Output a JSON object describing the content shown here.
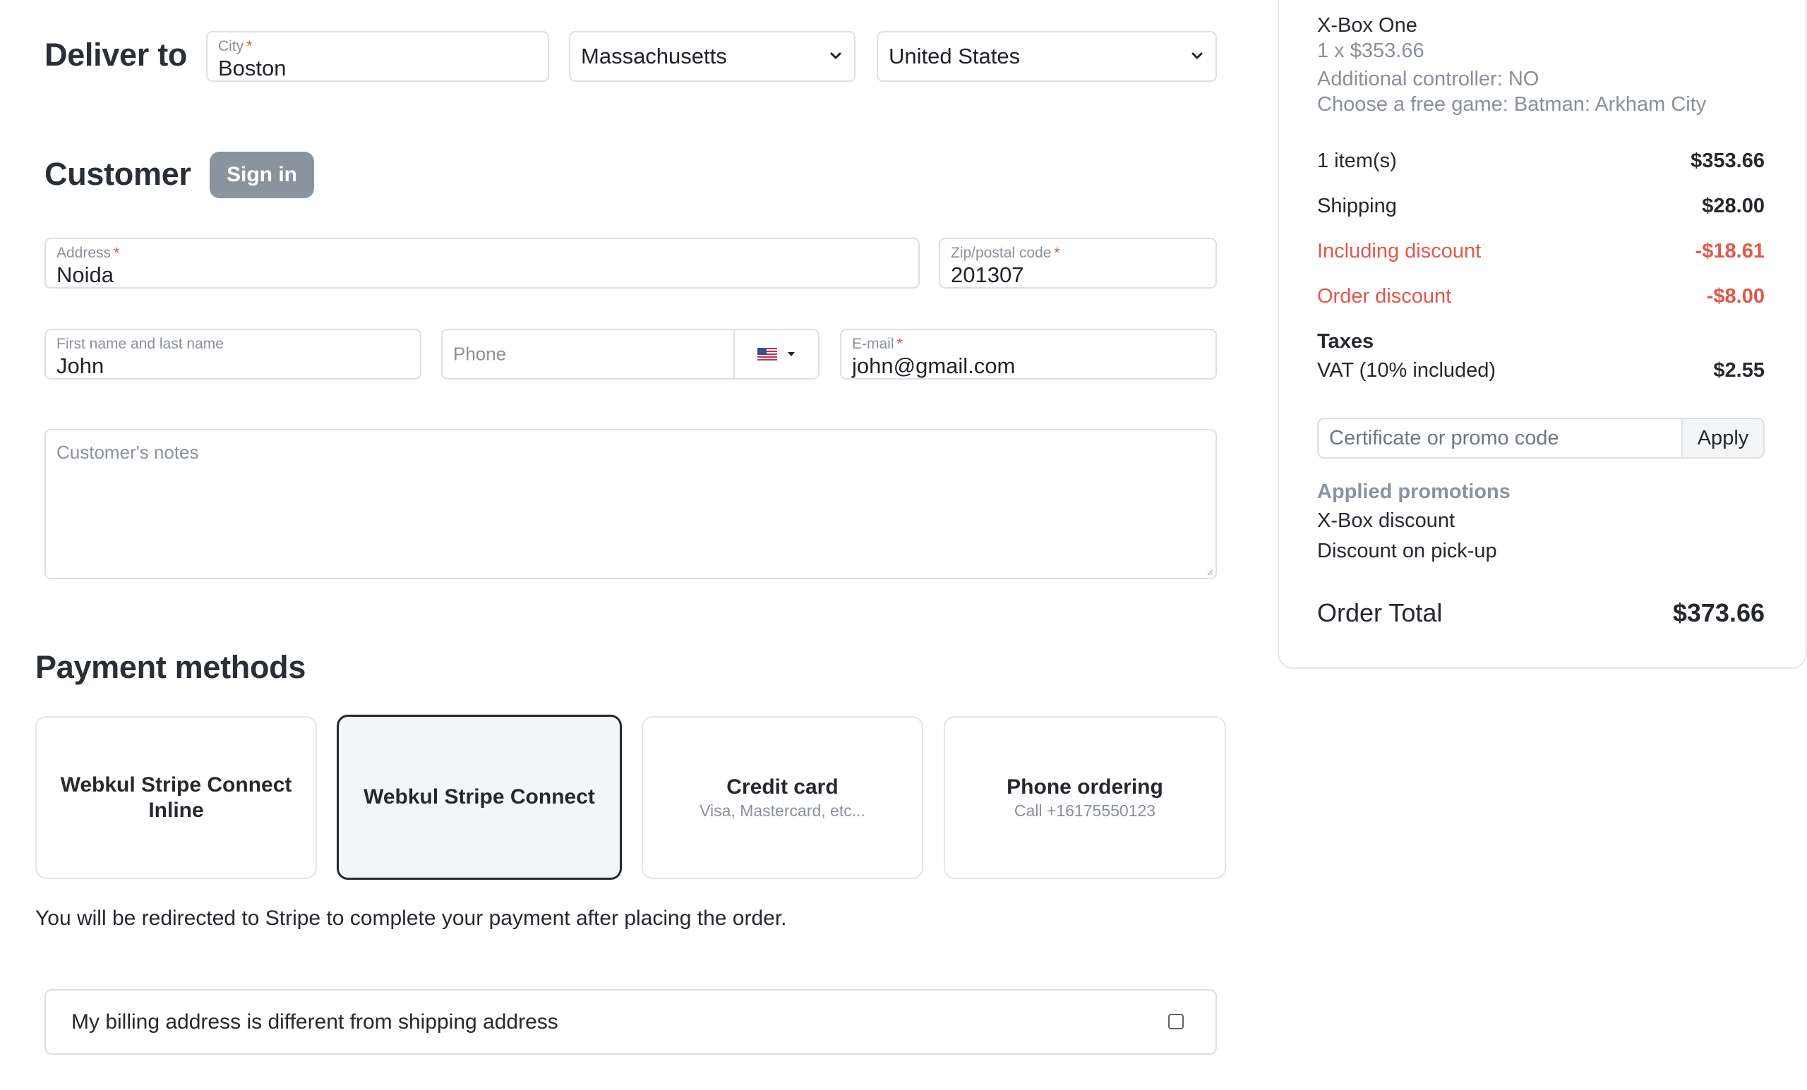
{
  "deliver": {
    "title": "Deliver to",
    "city_label": "City",
    "city_value": "Boston",
    "state_value": "Massachusetts",
    "country_value": "United States"
  },
  "customer": {
    "title": "Customer",
    "signin_label": "Sign in",
    "address_label": "Address",
    "address_value": "Noida",
    "zip_label": "Zip/postal code",
    "zip_value": "201307",
    "name_label": "First name and last name",
    "name_value": "John",
    "phone_placeholder": "Phone",
    "email_label": "E-mail",
    "email_value": "john@gmail.com",
    "notes_placeholder": "Customer's notes",
    "required_mark": "*"
  },
  "payment": {
    "title": "Payment methods",
    "methods": [
      {
        "title_line1": "Webkul Stripe Connect",
        "title_line2": "Inline",
        "sub": "",
        "selected": false
      },
      {
        "title_line1": "Webkul Stripe Connect",
        "title_line2": "",
        "sub": "",
        "selected": true
      },
      {
        "title_line1": "Credit card",
        "title_line2": "",
        "sub": "Visa, Mastercard, etc...",
        "selected": false
      },
      {
        "title_line1": "Phone ordering",
        "title_line2": "",
        "sub": "Call +16175550123",
        "selected": false
      }
    ],
    "redirect_note": "You will be redirected to Stripe to complete your payment after placing the order."
  },
  "billing": {
    "label": "My billing address is different from shipping address",
    "checked": false
  },
  "summary": {
    "product_name": "X-Box One",
    "product_qty": "1 x $353.66",
    "option1": "Additional controller: NO",
    "option2": "Choose a free game: Batman: Arkham City",
    "items_label": "1 item(s)",
    "items_amount": "$353.66",
    "shipping_label": "Shipping",
    "shipping_amount": "$28.00",
    "incl_discount_label": "Including discount",
    "incl_discount_amount": "-$18.61",
    "order_discount_label": "Order discount",
    "order_discount_amount": "-$8.00",
    "taxes_label": "Taxes",
    "vat_label": "VAT (10% included)",
    "vat_amount": "$2.55",
    "promo_placeholder": "Certificate or promo code",
    "apply_label": "Apply",
    "applied_title": "Applied promotions",
    "promo1": "X-Box discount",
    "promo2": "Discount on pick-up",
    "total_label": "Order Total",
    "total_amount": "$373.66"
  },
  "colors": {
    "accent_red": "#e0584c",
    "signin_bg": "#8a949e",
    "selected_border": "#25292e"
  },
  "icons": {
    "select_chevron": "chevron-down-icon",
    "phone_flag": "us-flag-icon",
    "flag_dropdown": "caret-down-icon"
  }
}
